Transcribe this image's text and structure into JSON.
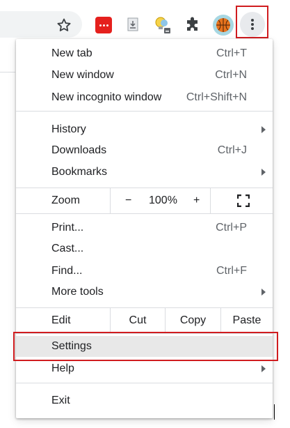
{
  "toolbar": {
    "icons": [
      "star-icon",
      "pocket-icon",
      "download-extension-icon",
      "lightbulb-extension-icon",
      "puzzle-extensions-icon",
      "profile-avatar-icon",
      "kebab-menu-icon"
    ]
  },
  "menu": {
    "new_tab": {
      "label": "New tab",
      "accel": "Ctrl+T"
    },
    "new_window": {
      "label": "New window",
      "accel": "Ctrl+N"
    },
    "new_incognito": {
      "label": "New incognito window",
      "accel": "Ctrl+Shift+N"
    },
    "history": {
      "label": "History"
    },
    "downloads": {
      "label": "Downloads",
      "accel": "Ctrl+J"
    },
    "bookmarks": {
      "label": "Bookmarks"
    },
    "zoom": {
      "label": "Zoom",
      "minus": "−",
      "value": "100%",
      "plus": "+"
    },
    "print": {
      "label": "Print...",
      "accel": "Ctrl+P"
    },
    "cast": {
      "label": "Cast..."
    },
    "find": {
      "label": "Find...",
      "accel": "Ctrl+F"
    },
    "more_tools": {
      "label": "More tools"
    },
    "edit": {
      "label": "Edit",
      "cut": "Cut",
      "copy": "Copy",
      "paste": "Paste"
    },
    "settings": {
      "label": "Settings"
    },
    "help": {
      "label": "Help"
    },
    "exit": {
      "label": "Exit"
    }
  },
  "colors": {
    "highlight_border": "#d01c1f",
    "accent": "#1a73e8",
    "pocket": "#e5201d"
  }
}
